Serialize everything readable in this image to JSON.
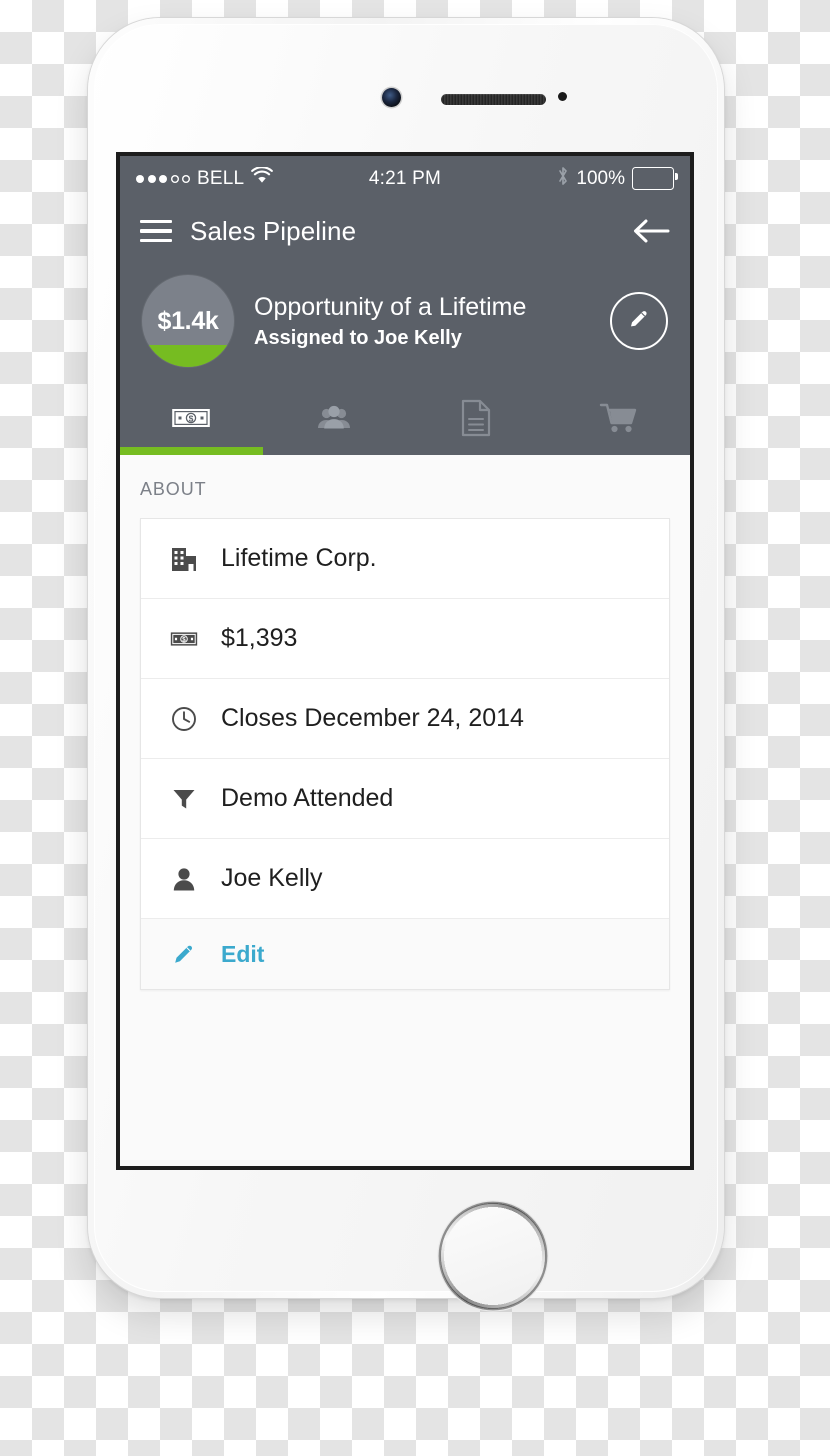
{
  "status_bar": {
    "carrier": "BELL",
    "signal_filled": 3,
    "signal_total": 5,
    "wifi_icon": "wifi-icon",
    "time": "4:21 PM",
    "bluetooth_icon": "bluetooth-icon",
    "battery_percent": "100%",
    "battery_icon": "battery-full-icon"
  },
  "nav_bar": {
    "menu_icon": "hamburger-menu-icon",
    "title": "Sales Pipeline",
    "back_icon": "arrow-left-icon"
  },
  "opportunity": {
    "amount_badge": "$1.4k",
    "title": "Opportunity of a Lifetime",
    "subtitle": "Assigned to Joe Kelly",
    "edit_icon": "pencil-icon",
    "progress_color": "#76bc21",
    "header_color": "#5b6068",
    "badge_color": "#7c818a"
  },
  "tabs": [
    {
      "name": "tab-deal",
      "icon": "money-bill-icon",
      "active": true
    },
    {
      "name": "tab-contacts",
      "icon": "people-group-icon",
      "active": false
    },
    {
      "name": "tab-documents",
      "icon": "document-icon",
      "active": false
    },
    {
      "name": "tab-products",
      "icon": "shopping-cart-icon",
      "active": false
    }
  ],
  "content": {
    "section_label": "ABOUT",
    "rows": [
      {
        "icon": "building-icon",
        "text": "Lifetime Corp."
      },
      {
        "icon": "money-bill-icon",
        "text": "$1,393"
      },
      {
        "icon": "clock-icon",
        "text": "Closes December 24, 2014"
      },
      {
        "icon": "funnel-icon",
        "text": "Demo Attended"
      },
      {
        "icon": "person-icon",
        "text": "Joe Kelly"
      }
    ],
    "edit": {
      "icon": "pencil-icon",
      "label": "Edit",
      "color": "#3ba9cd"
    }
  }
}
